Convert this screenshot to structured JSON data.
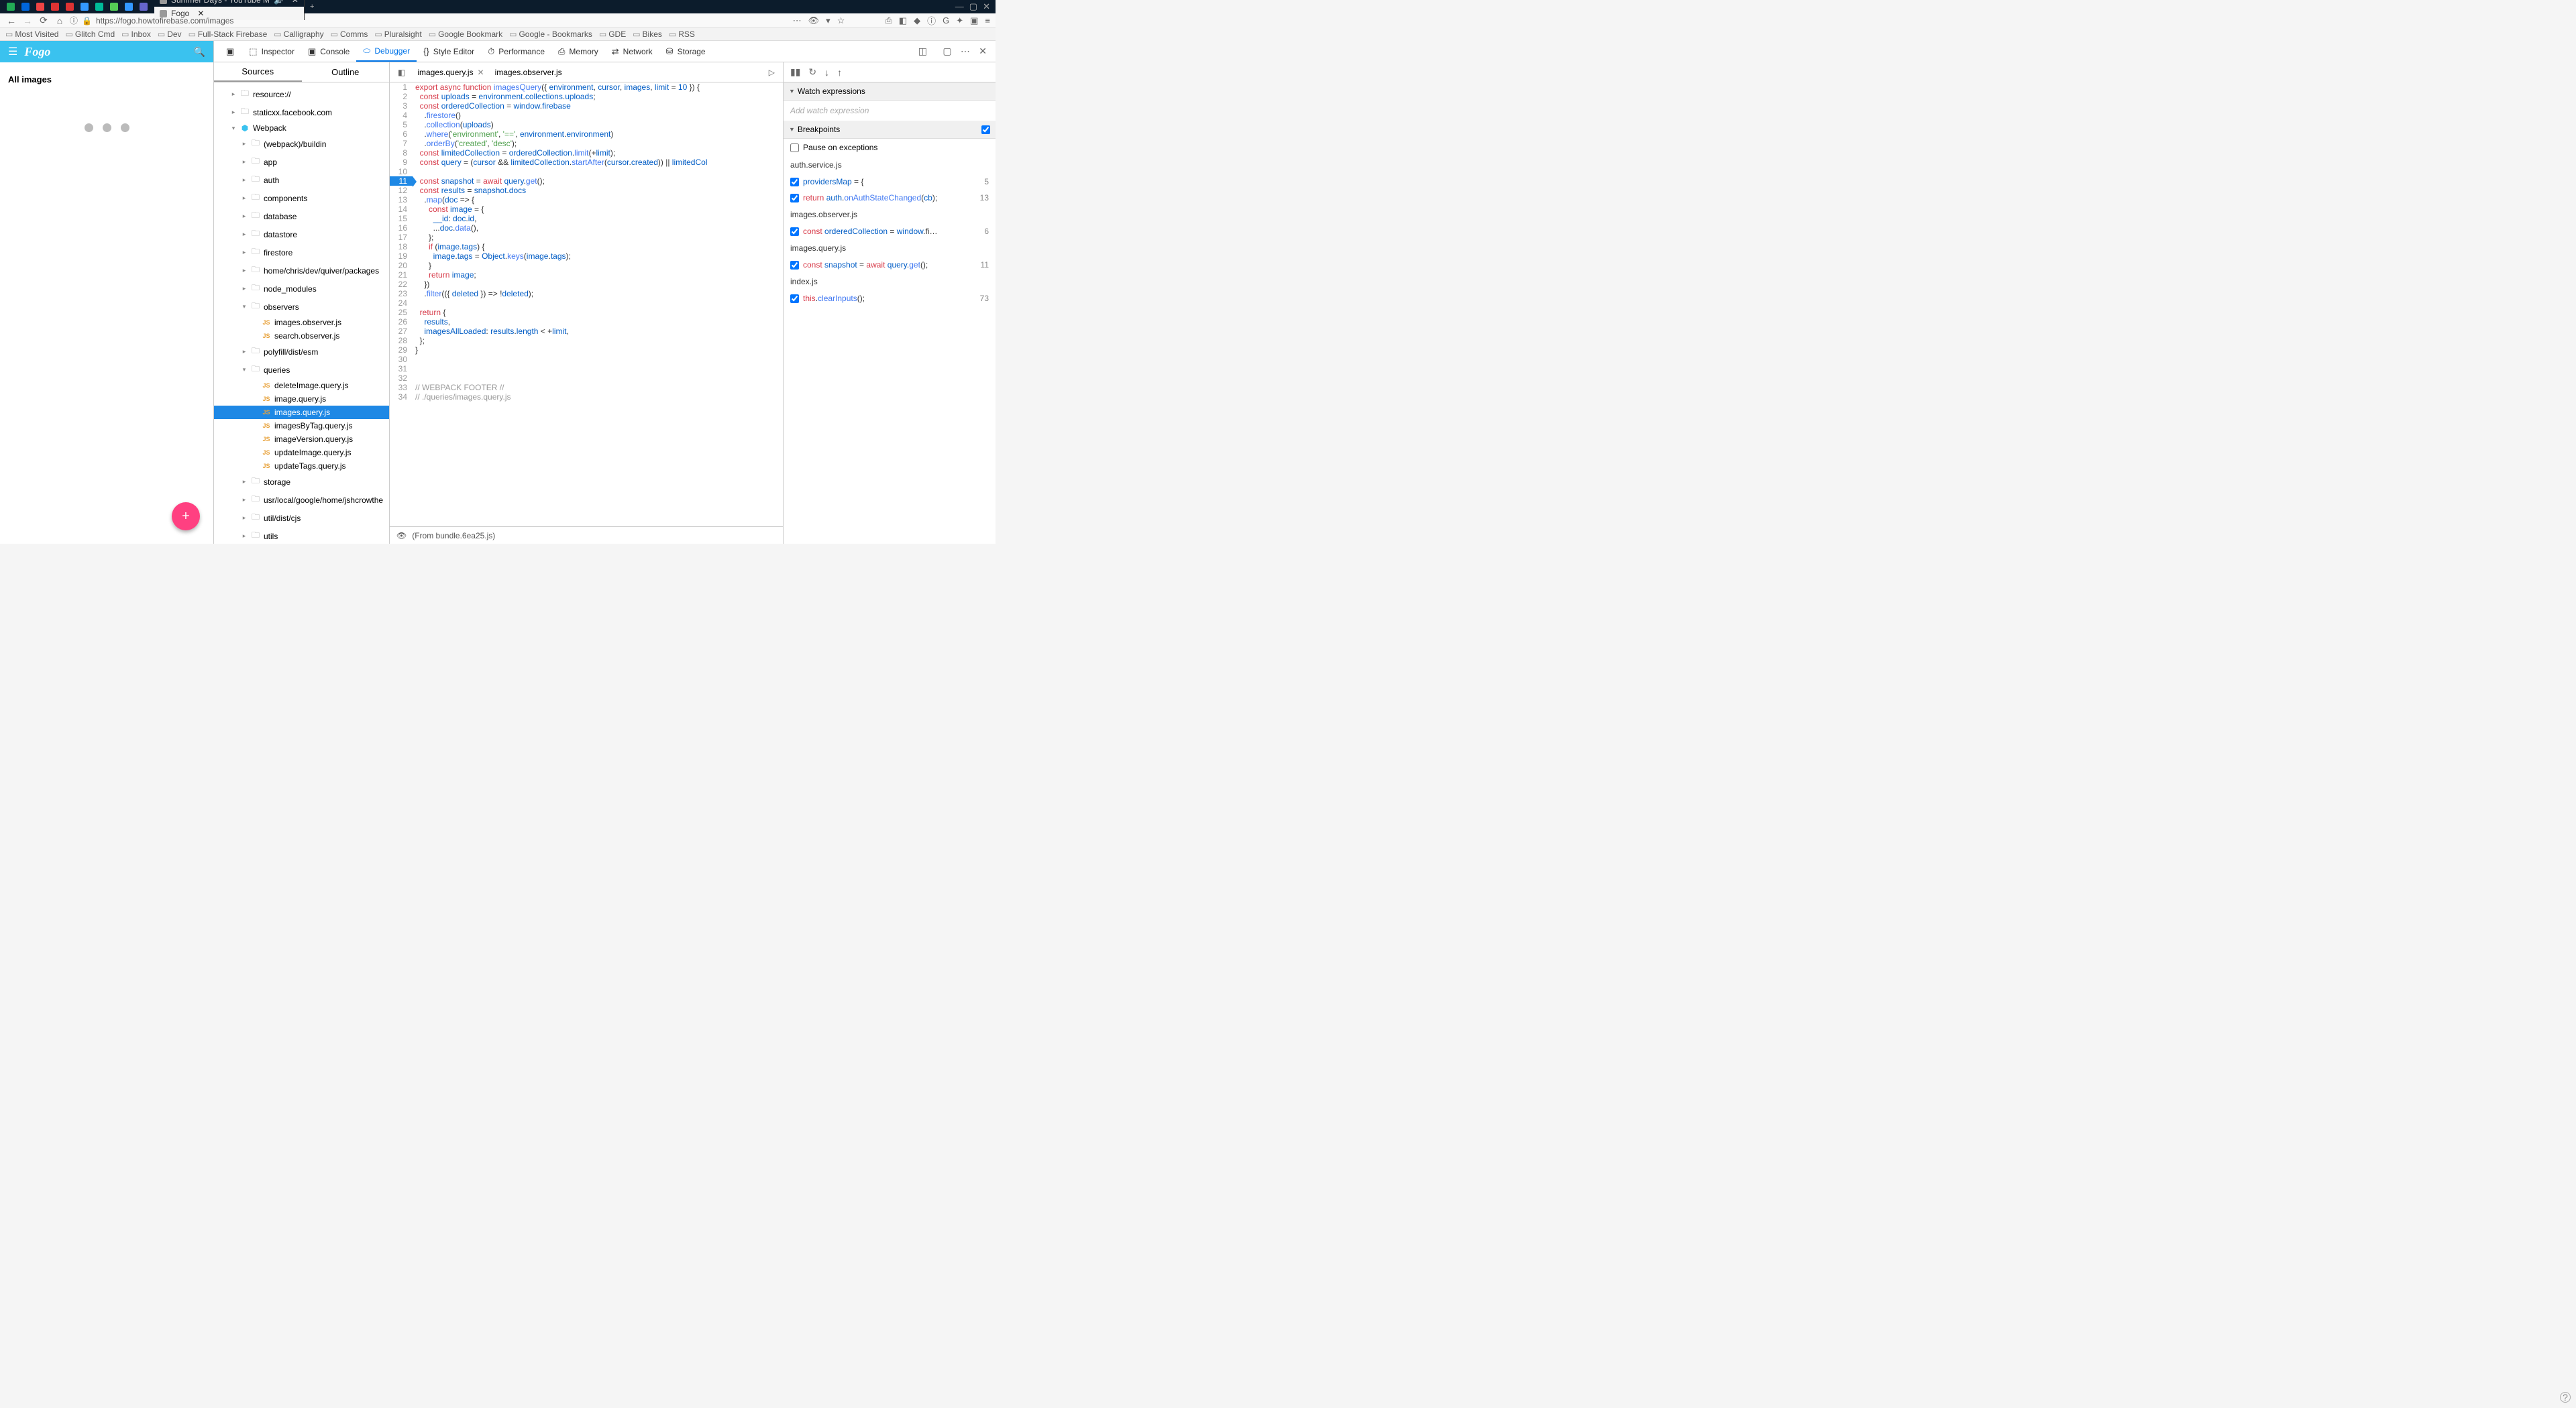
{
  "browser": {
    "tabs": [
      {
        "label": "Summer Days - YouTube M",
        "audio": true
      },
      {
        "label": "Fogo",
        "active": true
      }
    ],
    "url": "https://fogo.howtofirebase.com/images",
    "bookmarks": [
      "Most Visited",
      "Glitch Cmd",
      "Inbox",
      "Dev",
      "Full-Stack Firebase",
      "Calligraphy",
      "Comms",
      "Pluralsight",
      "Google Bookmark",
      "Google - Bookmarks",
      "GDE",
      "Bikes",
      "RSS"
    ]
  },
  "fogo": {
    "brand": "Fogo",
    "heading": "All images"
  },
  "devtools": {
    "tabs": [
      "Inspector",
      "Console",
      "Debugger",
      "Style Editor",
      "Performance",
      "Memory",
      "Network",
      "Storage"
    ],
    "activeTab": "Debugger",
    "sourcesTabs": [
      "Sources",
      "Outline"
    ],
    "tree": [
      {
        "label": "resource://",
        "indent": 1,
        "folder": true,
        "arrow": "▸"
      },
      {
        "label": "staticxx.facebook.com",
        "indent": 1,
        "folder": true,
        "arrow": "▸"
      },
      {
        "label": "Webpack",
        "indent": 1,
        "arrow": "▾",
        "webpack": true
      },
      {
        "label": "(webpack)/buildin",
        "indent": 2,
        "folder": true,
        "arrow": "▸"
      },
      {
        "label": "app",
        "indent": 2,
        "folder": true,
        "arrow": "▸"
      },
      {
        "label": "auth",
        "indent": 2,
        "folder": true,
        "arrow": "▸"
      },
      {
        "label": "components",
        "indent": 2,
        "folder": true,
        "arrow": "▸"
      },
      {
        "label": "database",
        "indent": 2,
        "folder": true,
        "arrow": "▸"
      },
      {
        "label": "datastore",
        "indent": 2,
        "folder": true,
        "arrow": "▸"
      },
      {
        "label": "firestore",
        "indent": 2,
        "folder": true,
        "arrow": "▸"
      },
      {
        "label": "home/chris/dev/quiver/packages",
        "indent": 2,
        "folder": true,
        "arrow": "▸"
      },
      {
        "label": "node_modules",
        "indent": 2,
        "folder": true,
        "arrow": "▸"
      },
      {
        "label": "observers",
        "indent": 2,
        "folder": true,
        "arrow": "▾"
      },
      {
        "label": "images.observer.js",
        "indent": 3,
        "js": true
      },
      {
        "label": "search.observer.js",
        "indent": 3,
        "js": true
      },
      {
        "label": "polyfill/dist/esm",
        "indent": 2,
        "folder": true,
        "arrow": "▸"
      },
      {
        "label": "queries",
        "indent": 2,
        "folder": true,
        "arrow": "▾"
      },
      {
        "label": "deleteImage.query.js",
        "indent": 3,
        "js": true
      },
      {
        "label": "image.query.js",
        "indent": 3,
        "js": true
      },
      {
        "label": "images.query.js",
        "indent": 3,
        "js": true,
        "selected": true
      },
      {
        "label": "imagesByTag.query.js",
        "indent": 3,
        "js": true
      },
      {
        "label": "imageVersion.query.js",
        "indent": 3,
        "js": true
      },
      {
        "label": "updateImage.query.js",
        "indent": 3,
        "js": true
      },
      {
        "label": "updateTags.query.js",
        "indent": 3,
        "js": true
      },
      {
        "label": "storage",
        "indent": 2,
        "folder": true,
        "arrow": "▸"
      },
      {
        "label": "usr/local/google/home/jshcrowthe",
        "indent": 2,
        "folder": true,
        "arrow": "▸"
      },
      {
        "label": "util/dist/cjs",
        "indent": 2,
        "folder": true,
        "arrow": "▸"
      },
      {
        "label": "utils",
        "indent": 2,
        "folder": true,
        "arrow": "▸"
      }
    ],
    "openFiles": [
      {
        "name": "images.query.js",
        "active": true
      },
      {
        "name": "images.observer.js"
      }
    ],
    "breakpointLine": 11,
    "footer": "(From bundle.6ea25.js)"
  },
  "debugPanel": {
    "watchHeader": "Watch expressions",
    "watchPlaceholder": "Add watch expression",
    "breakpointsHeader": "Breakpoints",
    "pauseLabel": "Pause on exceptions",
    "groups": [
      {
        "file": "auth.service.js",
        "items": [
          {
            "code": "providersMap = {",
            "line": "5",
            "tokens": [
              {
                "t": "providersMap",
                "c": "id"
              },
              {
                "t": " = {",
                "c": "op"
              }
            ]
          },
          {
            "code": "return auth.onAuthStateChanged(cb);",
            "line": "13",
            "tokens": [
              {
                "t": "return ",
                "c": "kw"
              },
              {
                "t": "auth",
                "c": "id"
              },
              {
                "t": ".",
                "c": "op"
              },
              {
                "t": "onAuthStateChanged",
                "c": "fn"
              },
              {
                "t": "(",
                "c": "op"
              },
              {
                "t": "cb",
                "c": "id"
              },
              {
                "t": ");",
                "c": "op"
              }
            ]
          }
        ]
      },
      {
        "file": "images.observer.js",
        "items": [
          {
            "code": "const orderedCollection = window.fi…",
            "line": "6",
            "tokens": [
              {
                "t": "const ",
                "c": "kw"
              },
              {
                "t": "orderedCollection",
                "c": "id"
              },
              {
                "t": " = ",
                "c": "op"
              },
              {
                "t": "window",
                "c": "id"
              },
              {
                "t": ".fi…",
                "c": "op"
              }
            ]
          }
        ]
      },
      {
        "file": "images.query.js",
        "items": [
          {
            "code": "const snapshot = await query.get();",
            "line": "11",
            "tokens": [
              {
                "t": "const ",
                "c": "kw"
              },
              {
                "t": "snapshot",
                "c": "id"
              },
              {
                "t": " = ",
                "c": "op"
              },
              {
                "t": "await ",
                "c": "kw"
              },
              {
                "t": "query",
                "c": "id"
              },
              {
                "t": ".",
                "c": "op"
              },
              {
                "t": "get",
                "c": "fn"
              },
              {
                "t": "();",
                "c": "op"
              }
            ]
          }
        ]
      },
      {
        "file": "index.js",
        "items": [
          {
            "code": "this.clearInputs();",
            "line": "73",
            "tokens": [
              {
                "t": "this",
                "c": "kw"
              },
              {
                "t": ".",
                "c": "op"
              },
              {
                "t": "clearInputs",
                "c": "fn"
              },
              {
                "t": "();",
                "c": "op"
              }
            ]
          }
        ]
      }
    ]
  },
  "code": [
    [
      {
        "t": "export ",
        "c": "kw"
      },
      {
        "t": "async ",
        "c": "kw"
      },
      {
        "t": "function ",
        "c": "kw"
      },
      {
        "t": "imagesQuery",
        "c": "fn"
      },
      {
        "t": "({ ",
        "c": "op"
      },
      {
        "t": "environment",
        "c": "id"
      },
      {
        "t": ", ",
        "c": "op"
      },
      {
        "t": "cursor",
        "c": "id"
      },
      {
        "t": ", ",
        "c": "op"
      },
      {
        "t": "images",
        "c": "id"
      },
      {
        "t": ", ",
        "c": "op"
      },
      {
        "t": "limit",
        "c": "id"
      },
      {
        "t": " = ",
        "c": "op"
      },
      {
        "t": "10",
        "c": "num"
      },
      {
        "t": " }) {",
        "c": "op"
      }
    ],
    [
      {
        "t": "  ",
        "c": "op"
      },
      {
        "t": "const ",
        "c": "kw"
      },
      {
        "t": "uploads",
        "c": "id"
      },
      {
        "t": " = ",
        "c": "op"
      },
      {
        "t": "environment",
        "c": "id"
      },
      {
        "t": ".",
        "c": "op"
      },
      {
        "t": "collections",
        "c": "id"
      },
      {
        "t": ".",
        "c": "op"
      },
      {
        "t": "uploads",
        "c": "id"
      },
      {
        "t": ";",
        "c": "op"
      }
    ],
    [
      {
        "t": "  ",
        "c": "op"
      },
      {
        "t": "const ",
        "c": "kw"
      },
      {
        "t": "orderedCollection",
        "c": "id"
      },
      {
        "t": " = ",
        "c": "op"
      },
      {
        "t": "window",
        "c": "id"
      },
      {
        "t": ".",
        "c": "op"
      },
      {
        "t": "firebase",
        "c": "id"
      }
    ],
    [
      {
        "t": "    .",
        "c": "op"
      },
      {
        "t": "firestore",
        "c": "fn"
      },
      {
        "t": "()",
        "c": "op"
      }
    ],
    [
      {
        "t": "    .",
        "c": "op"
      },
      {
        "t": "collection",
        "c": "fn"
      },
      {
        "t": "(",
        "c": "op"
      },
      {
        "t": "uploads",
        "c": "id"
      },
      {
        "t": ")",
        "c": "op"
      }
    ],
    [
      {
        "t": "    .",
        "c": "op"
      },
      {
        "t": "where",
        "c": "fn"
      },
      {
        "t": "(",
        "c": "op"
      },
      {
        "t": "'environment'",
        "c": "str"
      },
      {
        "t": ", ",
        "c": "op"
      },
      {
        "t": "'=='",
        "c": "str"
      },
      {
        "t": ", ",
        "c": "op"
      },
      {
        "t": "environment",
        "c": "id"
      },
      {
        "t": ".",
        "c": "op"
      },
      {
        "t": "environment",
        "c": "id"
      },
      {
        "t": ")",
        "c": "op"
      }
    ],
    [
      {
        "t": "    .",
        "c": "op"
      },
      {
        "t": "orderBy",
        "c": "fn"
      },
      {
        "t": "(",
        "c": "op"
      },
      {
        "t": "'created'",
        "c": "str"
      },
      {
        "t": ", ",
        "c": "op"
      },
      {
        "t": "'desc'",
        "c": "str"
      },
      {
        "t": ");",
        "c": "op"
      }
    ],
    [
      {
        "t": "  ",
        "c": "op"
      },
      {
        "t": "const ",
        "c": "kw"
      },
      {
        "t": "limitedCollection",
        "c": "id"
      },
      {
        "t": " = ",
        "c": "op"
      },
      {
        "t": "orderedCollection",
        "c": "id"
      },
      {
        "t": ".",
        "c": "op"
      },
      {
        "t": "limit",
        "c": "fn"
      },
      {
        "t": "(+",
        "c": "op"
      },
      {
        "t": "limit",
        "c": "id"
      },
      {
        "t": ");",
        "c": "op"
      }
    ],
    [
      {
        "t": "  ",
        "c": "op"
      },
      {
        "t": "const ",
        "c": "kw"
      },
      {
        "t": "query",
        "c": "id"
      },
      {
        "t": " = (",
        "c": "op"
      },
      {
        "t": "cursor",
        "c": "id"
      },
      {
        "t": " && ",
        "c": "op"
      },
      {
        "t": "limitedCollection",
        "c": "id"
      },
      {
        "t": ".",
        "c": "op"
      },
      {
        "t": "startAfter",
        "c": "fn"
      },
      {
        "t": "(",
        "c": "op"
      },
      {
        "t": "cursor",
        "c": "id"
      },
      {
        "t": ".",
        "c": "op"
      },
      {
        "t": "created",
        "c": "id"
      },
      {
        "t": ")) || ",
        "c": "op"
      },
      {
        "t": "limitedCol",
        "c": "id"
      }
    ],
    [
      {
        "t": "",
        "c": "op"
      }
    ],
    [
      {
        "t": "  ",
        "c": "op"
      },
      {
        "t": "const ",
        "c": "kw"
      },
      {
        "t": "snapshot",
        "c": "id"
      },
      {
        "t": " = ",
        "c": "op"
      },
      {
        "t": "await ",
        "c": "kw"
      },
      {
        "t": "query",
        "c": "id"
      },
      {
        "t": ".",
        "c": "op"
      },
      {
        "t": "get",
        "c": "fn"
      },
      {
        "t": "();",
        "c": "op"
      }
    ],
    [
      {
        "t": "  ",
        "c": "op"
      },
      {
        "t": "const ",
        "c": "kw"
      },
      {
        "t": "results",
        "c": "id"
      },
      {
        "t": " = ",
        "c": "op"
      },
      {
        "t": "snapshot",
        "c": "id"
      },
      {
        "t": ".",
        "c": "op"
      },
      {
        "t": "docs",
        "c": "id"
      }
    ],
    [
      {
        "t": "    .",
        "c": "op"
      },
      {
        "t": "map",
        "c": "fn"
      },
      {
        "t": "(",
        "c": "op"
      },
      {
        "t": "doc",
        "c": "id"
      },
      {
        "t": " => {",
        "c": "op"
      }
    ],
    [
      {
        "t": "      ",
        "c": "op"
      },
      {
        "t": "const ",
        "c": "kw"
      },
      {
        "t": "image",
        "c": "id"
      },
      {
        "t": " = {",
        "c": "op"
      }
    ],
    [
      {
        "t": "        ",
        "c": "op"
      },
      {
        "t": "__id",
        "c": "id"
      },
      {
        "t": ": ",
        "c": "op"
      },
      {
        "t": "doc",
        "c": "id"
      },
      {
        "t": ".",
        "c": "op"
      },
      {
        "t": "id",
        "c": "id"
      },
      {
        "t": ",",
        "c": "op"
      }
    ],
    [
      {
        "t": "        ...",
        "c": "op"
      },
      {
        "t": "doc",
        "c": "id"
      },
      {
        "t": ".",
        "c": "op"
      },
      {
        "t": "data",
        "c": "fn"
      },
      {
        "t": "(),",
        "c": "op"
      }
    ],
    [
      {
        "t": "      };",
        "c": "op"
      }
    ],
    [
      {
        "t": "      ",
        "c": "op"
      },
      {
        "t": "if ",
        "c": "kw"
      },
      {
        "t": "(",
        "c": "op"
      },
      {
        "t": "image",
        "c": "id"
      },
      {
        "t": ".",
        "c": "op"
      },
      {
        "t": "tags",
        "c": "id"
      },
      {
        "t": ") {",
        "c": "op"
      }
    ],
    [
      {
        "t": "        ",
        "c": "op"
      },
      {
        "t": "image",
        "c": "id"
      },
      {
        "t": ".",
        "c": "op"
      },
      {
        "t": "tags",
        "c": "id"
      },
      {
        "t": " = ",
        "c": "op"
      },
      {
        "t": "Object",
        "c": "id"
      },
      {
        "t": ".",
        "c": "op"
      },
      {
        "t": "keys",
        "c": "fn"
      },
      {
        "t": "(",
        "c": "op"
      },
      {
        "t": "image",
        "c": "id"
      },
      {
        "t": ".",
        "c": "op"
      },
      {
        "t": "tags",
        "c": "id"
      },
      {
        "t": ");",
        "c": "op"
      }
    ],
    [
      {
        "t": "      }",
        "c": "op"
      }
    ],
    [
      {
        "t": "      ",
        "c": "op"
      },
      {
        "t": "return ",
        "c": "kw"
      },
      {
        "t": "image",
        "c": "id"
      },
      {
        "t": ";",
        "c": "op"
      }
    ],
    [
      {
        "t": "    })",
        "c": "op"
      }
    ],
    [
      {
        "t": "    .",
        "c": "op"
      },
      {
        "t": "filter",
        "c": "fn"
      },
      {
        "t": "(({ ",
        "c": "op"
      },
      {
        "t": "deleted",
        "c": "id"
      },
      {
        "t": " }) => !",
        "c": "op"
      },
      {
        "t": "deleted",
        "c": "id"
      },
      {
        "t": ");",
        "c": "op"
      }
    ],
    [
      {
        "t": "",
        "c": "op"
      }
    ],
    [
      {
        "t": "  ",
        "c": "op"
      },
      {
        "t": "return ",
        "c": "kw"
      },
      {
        "t": "{",
        "c": "op"
      }
    ],
    [
      {
        "t": "    ",
        "c": "op"
      },
      {
        "t": "results",
        "c": "id"
      },
      {
        "t": ",",
        "c": "op"
      }
    ],
    [
      {
        "t": "    ",
        "c": "op"
      },
      {
        "t": "imagesAllLoaded",
        "c": "id"
      },
      {
        "t": ": ",
        "c": "op"
      },
      {
        "t": "results",
        "c": "id"
      },
      {
        "t": ".",
        "c": "op"
      },
      {
        "t": "length",
        "c": "id"
      },
      {
        "t": " < +",
        "c": "op"
      },
      {
        "t": "limit",
        "c": "id"
      },
      {
        "t": ",",
        "c": "op"
      }
    ],
    [
      {
        "t": "  };",
        "c": "op"
      }
    ],
    [
      {
        "t": "}",
        "c": "op"
      }
    ],
    [
      {
        "t": "",
        "c": "op"
      }
    ],
    [
      {
        "t": "",
        "c": "op"
      }
    ],
    [
      {
        "t": "",
        "c": "op"
      }
    ],
    [
      {
        "t": "// WEBPACK FOOTER //",
        "c": "cm"
      }
    ],
    [
      {
        "t": "// ./queries/images.query.js",
        "c": "cm"
      }
    ]
  ]
}
